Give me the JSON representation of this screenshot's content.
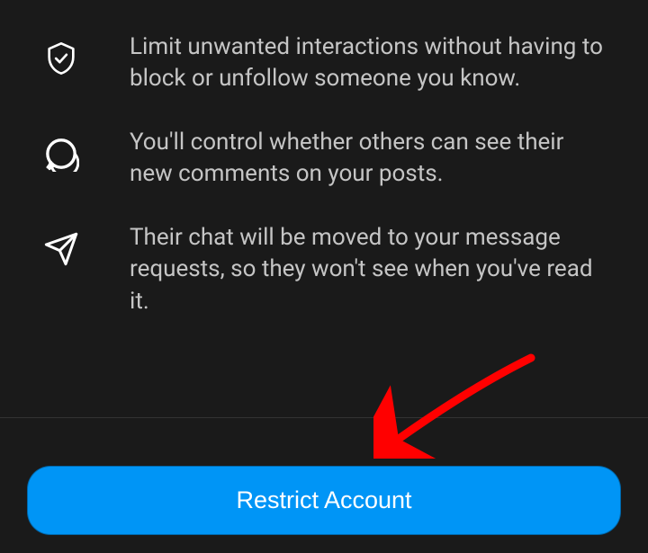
{
  "info": {
    "shield": "Limit unwanted interactions without having to block or unfollow someone you know.",
    "comment": "You'll control whether others can see their new comments on your posts.",
    "send": "Their chat will be moved to your message requests, so they won't see when you've read it."
  },
  "button": {
    "restrict": "Restrict Account"
  }
}
